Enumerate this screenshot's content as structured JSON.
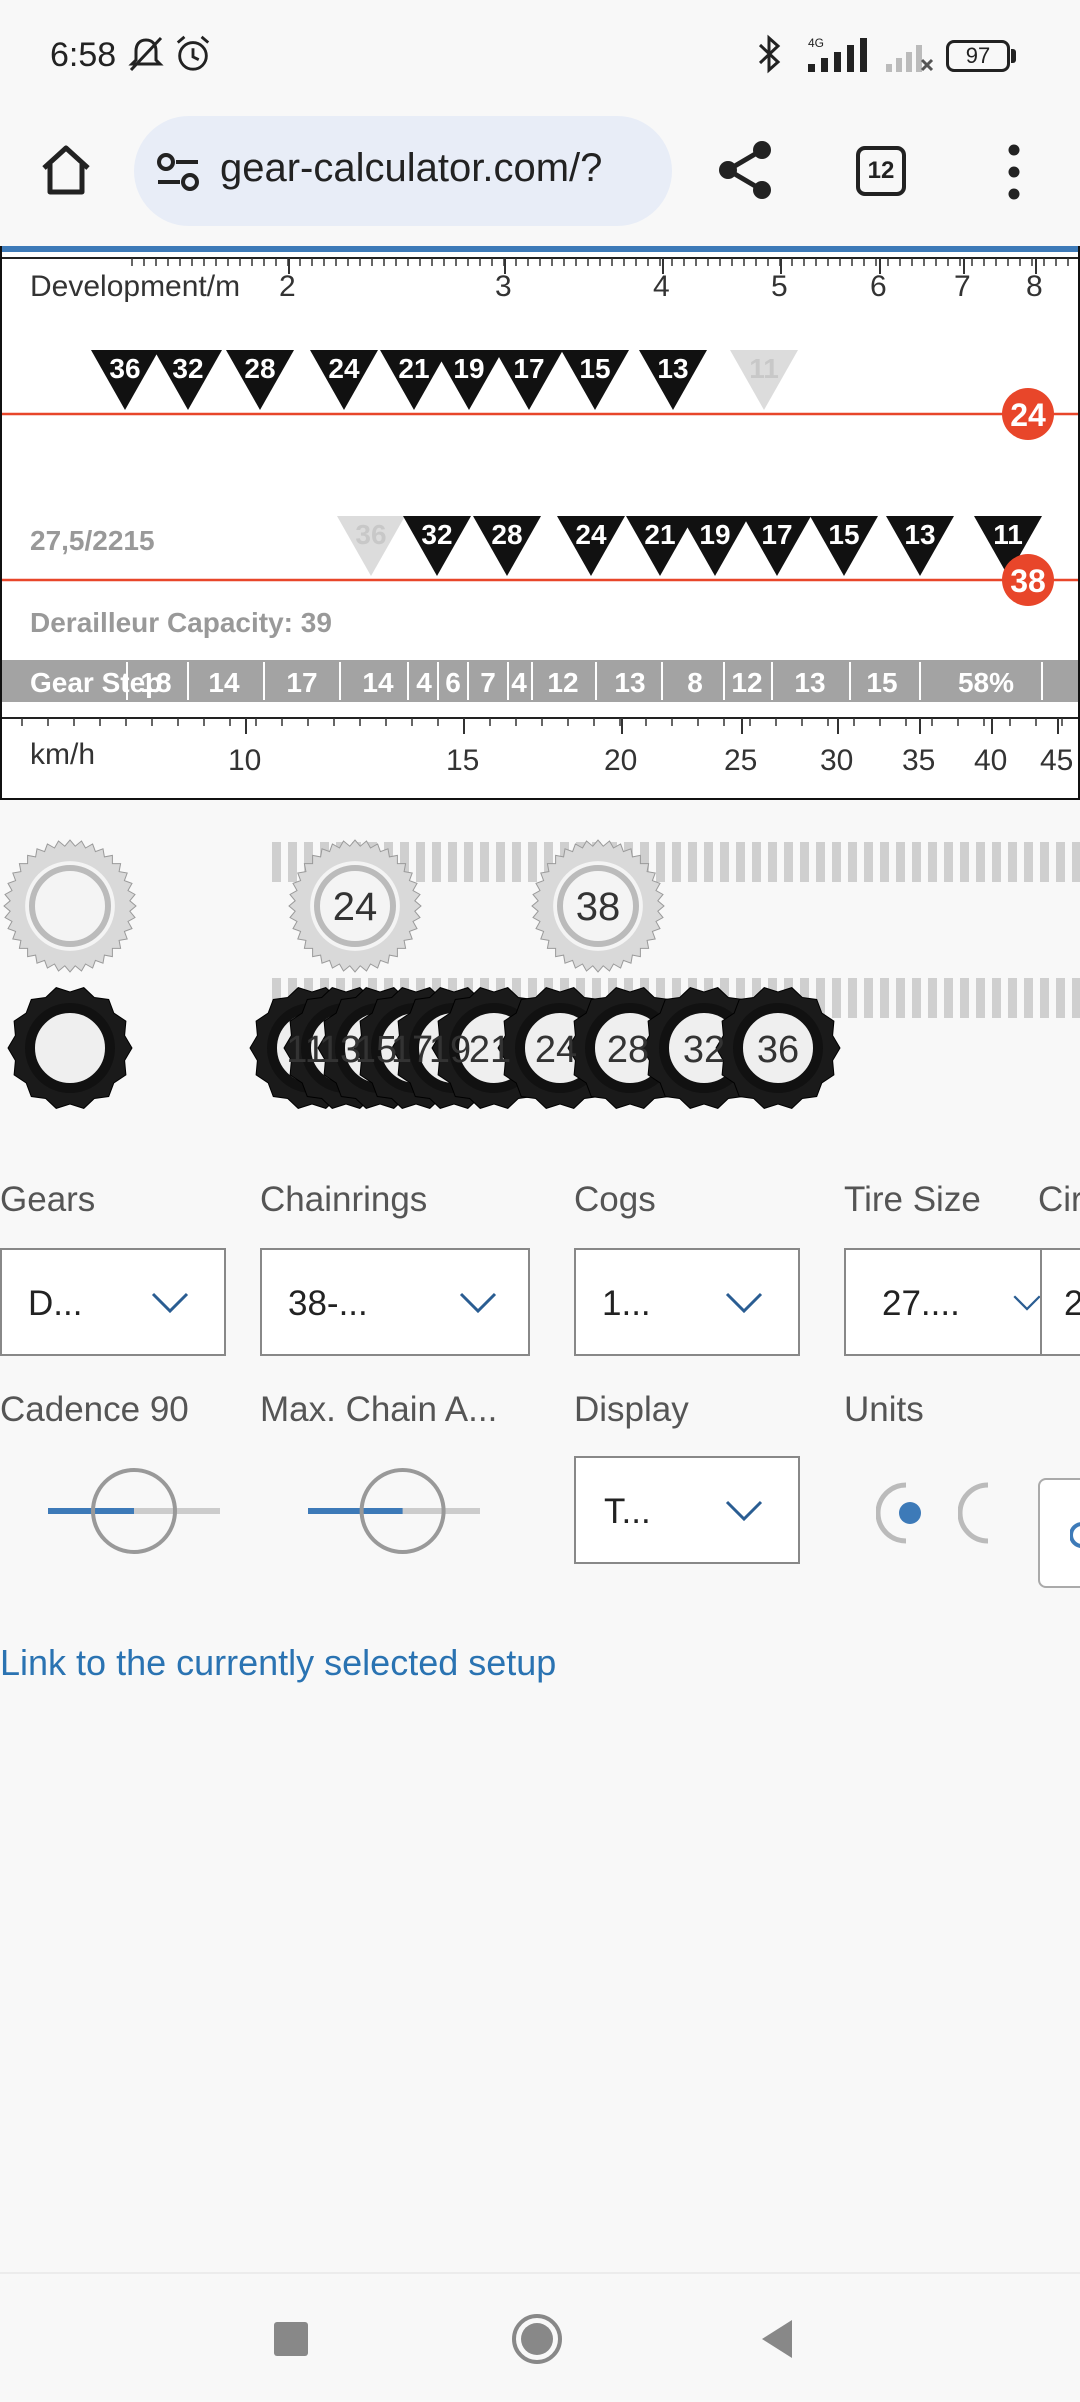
{
  "status": {
    "time": "6:58",
    "battery": "97"
  },
  "browser": {
    "url": "gear-calculator.com/?",
    "tab_count": "12"
  },
  "chart_data": {
    "type": "table",
    "development_axis": {
      "label": "Development/m",
      "ticks": [
        "2",
        "3",
        "4",
        "5",
        "6",
        "7",
        "8"
      ]
    },
    "speed_axis": {
      "label": "km/h",
      "ticks": [
        "10",
        "15",
        "20",
        "25",
        "30",
        "35",
        "40",
        "45"
      ]
    },
    "row1": {
      "chainring": "24",
      "cogs": [
        "36",
        "32",
        "28",
        "24",
        "21",
        "19",
        "17",
        "15",
        "13",
        "11"
      ]
    },
    "row2": {
      "chainring": "38",
      "label": "27,5/2215",
      "cogs": [
        "36",
        "32",
        "28",
        "24",
        "21",
        "19",
        "17",
        "15",
        "13",
        "11"
      ]
    },
    "derailleur_capacity": "Derailleur Capacity: 39",
    "gear_steps": {
      "label": "Gear Step",
      "values": [
        "18",
        "14",
        "17",
        "14",
        "4",
        "6",
        "7",
        "4",
        "12",
        "13",
        "8",
        "12",
        "13",
        "15",
        "58%"
      ]
    }
  },
  "gears_visual": {
    "chainrings": [
      "24",
      "38"
    ],
    "cogs": [
      "11",
      "13",
      "15",
      "17",
      "19",
      "21",
      "24",
      "28",
      "32",
      "36"
    ]
  },
  "controls": {
    "gears": {
      "label": "Gears",
      "value": "D..."
    },
    "chainrings": {
      "label": "Chainrings",
      "value": "38-..."
    },
    "cogs": {
      "label": "Cogs",
      "value": "1..."
    },
    "tire_size": {
      "label": "Tire Size",
      "value": "27...."
    },
    "circumference": {
      "label": "Cir",
      "value": "2"
    },
    "cadence": {
      "label": "Cadence 90",
      "level": 0.5
    },
    "max_chain_angle": {
      "label": "Max. Chain A...",
      "level": 0.55
    },
    "display": {
      "label": "Display",
      "value": "T..."
    },
    "units": {
      "label": "Units"
    }
  },
  "link_text": "Link to the currently selected setup",
  "colors": {
    "accent": "#3d7ab8",
    "chainring_badge": "#e8462a",
    "link": "#2a73b2"
  }
}
